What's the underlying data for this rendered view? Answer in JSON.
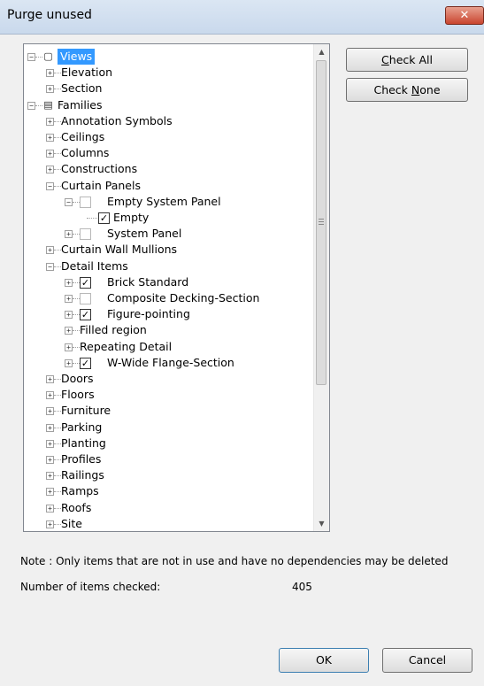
{
  "window": {
    "title": "Purge unused",
    "close_glyph": "✕"
  },
  "buttons": {
    "check_all": "Check All",
    "check_none": "Check None",
    "ok": "OK",
    "cancel": "Cancel"
  },
  "tree": [
    {
      "level": 0,
      "expander": "minus",
      "icon": "views-icon",
      "label": "Views",
      "selected": true
    },
    {
      "level": 1,
      "expander": "plus",
      "label": "Elevation"
    },
    {
      "level": 1,
      "expander": "plus",
      "label": "Section"
    },
    {
      "level": 0,
      "expander": "minus",
      "icon": "families-icon",
      "label": "Families"
    },
    {
      "level": 1,
      "expander": "plus",
      "label": "Annotation Symbols"
    },
    {
      "level": 1,
      "expander": "plus",
      "label": "Ceilings"
    },
    {
      "level": 1,
      "expander": "plus",
      "label": "Columns"
    },
    {
      "level": 1,
      "expander": "plus",
      "label": "Constructions"
    },
    {
      "level": 1,
      "expander": "minus",
      "label": "Curtain Panels"
    },
    {
      "level": 2,
      "expander": "minus",
      "checkbox": "off",
      "label": "Empty System Panel"
    },
    {
      "level": 3,
      "checkbox": "on",
      "label": "Empty"
    },
    {
      "level": 2,
      "expander": "plus",
      "checkbox": "off",
      "label": "System Panel"
    },
    {
      "level": 1,
      "expander": "plus",
      "label": "Curtain Wall Mullions"
    },
    {
      "level": 1,
      "expander": "minus",
      "label": "Detail Items"
    },
    {
      "level": 2,
      "expander": "plus",
      "checkbox": "on",
      "label": "Brick Standard"
    },
    {
      "level": 2,
      "expander": "plus",
      "checkbox": "off",
      "label": "Composite Decking-Section"
    },
    {
      "level": 2,
      "expander": "plus",
      "checkbox": "on",
      "label": "Figure-pointing"
    },
    {
      "level": 2,
      "expander": "plus",
      "label": "Filled region"
    },
    {
      "level": 2,
      "expander": "plus",
      "label": "Repeating Detail"
    },
    {
      "level": 2,
      "expander": "plus",
      "checkbox": "on",
      "label": "W-Wide Flange-Section"
    },
    {
      "level": 1,
      "expander": "plus",
      "label": "Doors"
    },
    {
      "level": 1,
      "expander": "plus",
      "label": "Floors"
    },
    {
      "level": 1,
      "expander": "plus",
      "label": "Furniture"
    },
    {
      "level": 1,
      "expander": "plus",
      "label": "Parking"
    },
    {
      "level": 1,
      "expander": "plus",
      "label": "Planting"
    },
    {
      "level": 1,
      "expander": "plus",
      "label": "Profiles"
    },
    {
      "level": 1,
      "expander": "plus",
      "label": "Railings"
    },
    {
      "level": 1,
      "expander": "plus",
      "label": "Ramps"
    },
    {
      "level": 1,
      "expander": "plus",
      "label": "Roofs"
    },
    {
      "level": 1,
      "expander": "plus",
      "label": "Site"
    }
  ],
  "note": "Note : Only items that are not in use and have no dependencies may be deleted",
  "count_label": "Number of items checked:",
  "count_value": "405",
  "colors": {
    "selection": "#3399ff",
    "close_button": "#c9452f"
  }
}
